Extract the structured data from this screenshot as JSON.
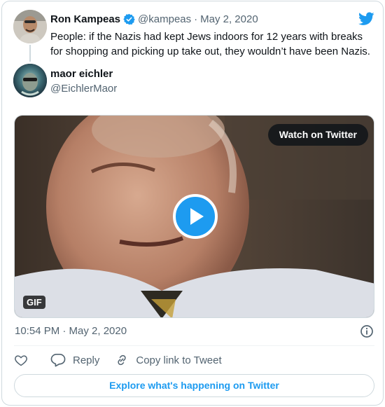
{
  "quoted_tweet": {
    "author_name": "Ron Kampeas",
    "handle": "@kampeas",
    "separator": "·",
    "date": "May 2, 2020",
    "text": "People: if the Nazis had kept Jews indoors for 12 years with breaks for shopping and picking up take out, they wouldn’t have been Nazis."
  },
  "tweet": {
    "author_name": "maor eichler",
    "handle": "@EichlerMaor",
    "media": {
      "watch_label": "Watch on Twitter",
      "badge": "GIF"
    },
    "timestamp": "10:54 PM · May 2, 2020"
  },
  "actions": {
    "reply_label": "Reply",
    "copy_label": "Copy link to Tweet"
  },
  "explore_label": "Explore what's happening on Twitter",
  "colors": {
    "accent": "#1d9bf0",
    "text": "#0f1419",
    "muted": "#536471",
    "border": "#cfd9de"
  },
  "icons": [
    "twitter-bird-icon",
    "verified-badge-icon",
    "play-icon",
    "info-icon",
    "heart-icon",
    "reply-icon",
    "link-icon"
  ]
}
